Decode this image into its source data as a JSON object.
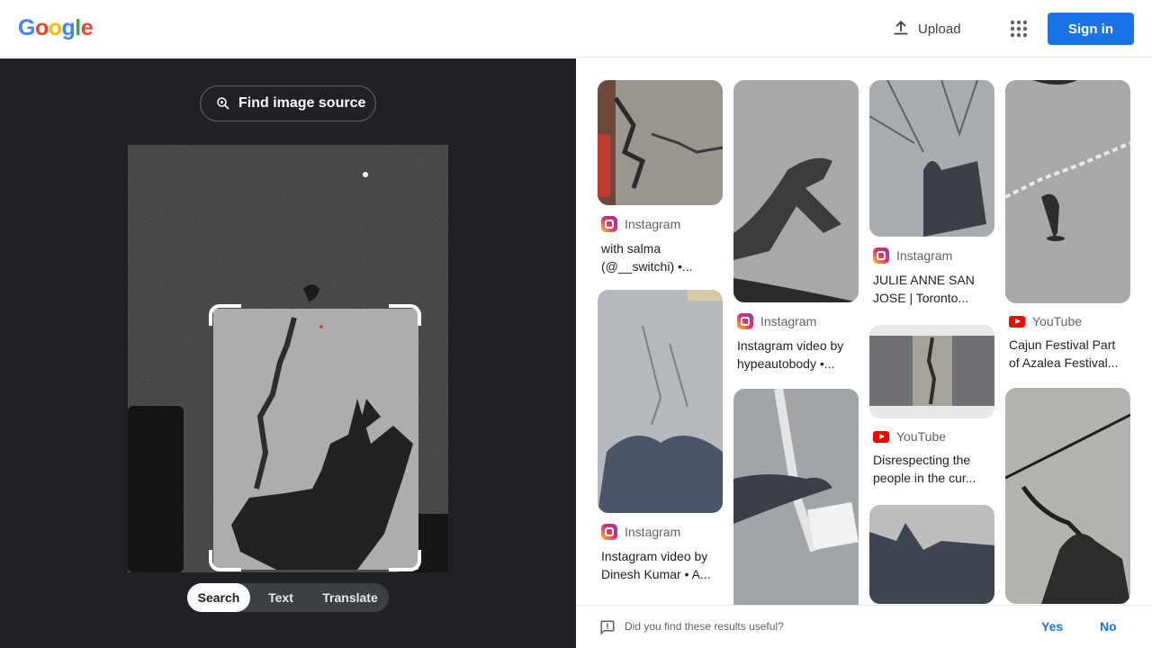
{
  "header": {
    "logo": [
      "G",
      "o",
      "o",
      "g",
      "l",
      "e"
    ],
    "logo_colors": [
      "#4285f4",
      "#ea4335",
      "#fbbc05",
      "#4285f4",
      "#34a853",
      "#ea4335"
    ],
    "upload_label": "Upload",
    "apps_icon": "apps-grid-icon",
    "signin_label": "Sign in"
  },
  "lens": {
    "find_source_label": "Find image source",
    "modes": [
      "Search",
      "Text",
      "Translate"
    ],
    "active_mode": "Search"
  },
  "results": [
    {
      "source": "Instagram",
      "source_type": "instagram",
      "title": "with salma (@__switchi) •..."
    },
    {
      "source": "Instagram",
      "source_type": "instagram",
      "title": "Instagram video by Dinesh Kumar • A..."
    },
    {
      "source": "Instagram",
      "source_type": "instagram",
      "title": "Instagram video by hypeautobody •..."
    },
    {
      "source": "Instagram",
      "source_type": "instagram",
      "title": "JULIE ANNE SAN JOSE | Toronto..."
    },
    {
      "source": "YouTube",
      "source_type": "youtube",
      "title": "Disrespecting the people in the cur..."
    },
    {
      "source": "YouTube",
      "source_type": "youtube",
      "title": "Cajun Festival Part of Azalea Festival..."
    }
  ],
  "feedback": {
    "question": "Did you find these results useful?",
    "yes": "Yes",
    "no": "No"
  },
  "colors": {
    "accent": "#1a73e8",
    "dark_bg": "#202124",
    "instagram": "#e1306c",
    "youtube": "#ff0000"
  }
}
